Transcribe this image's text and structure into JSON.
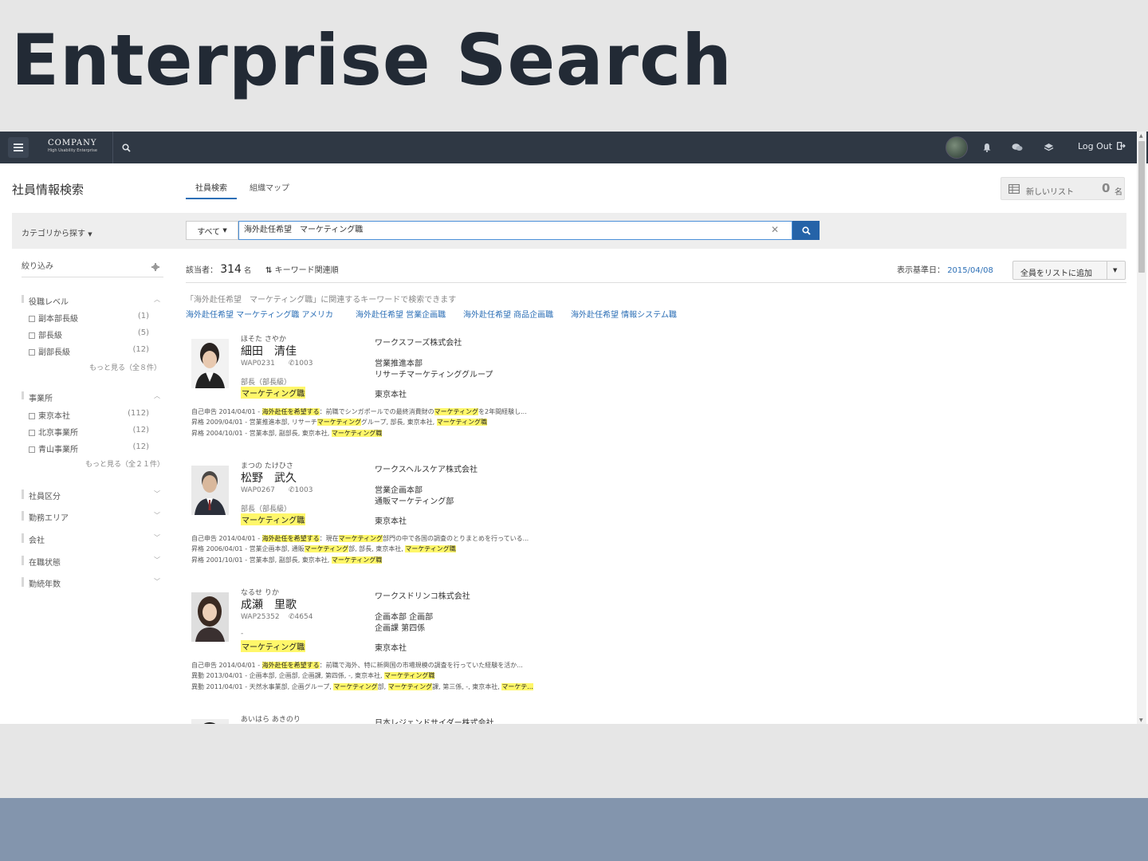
{
  "slide": {
    "title": "Enterprise Search"
  },
  "nav": {
    "logo_main": "COMPANY",
    "logo_sub": "High Usability Enterprise",
    "logout": "Log Out"
  },
  "page": {
    "title": "社員情報検索",
    "tabs": [
      "社員検索",
      "組織マップ"
    ],
    "new_list": "新しいリスト",
    "list_count": "0",
    "list_unit": "名"
  },
  "search": {
    "category": "カテゴリから探す",
    "scope": "すべて",
    "query": "海外赴任希望　マーケティング職"
  },
  "sidebar": {
    "heading": "絞り込み",
    "groups": [
      {
        "title": "役職レベル",
        "items": [
          {
            "label": "副本部長級",
            "count": "(1)"
          },
          {
            "label": "部長級",
            "count": "(5)"
          },
          {
            "label": "副部長級",
            "count": "(12)"
          }
        ],
        "more": "もっと見る（全８件）"
      },
      {
        "title": "事業所",
        "items": [
          {
            "label": "東京本社",
            "count": "(112)"
          },
          {
            "label": "北京事業所",
            "count": "(12)"
          },
          {
            "label": "青山事業所",
            "count": "(12)"
          }
        ],
        "more": "もっと見る（全２１件）"
      }
    ],
    "collapsed": [
      "社員区分",
      "勤務エリア",
      "会社",
      "在職状態",
      "勤続年数"
    ]
  },
  "results": {
    "count_label": "該当者：",
    "count": "314",
    "count_unit": "名",
    "sort_label": "キーワード関連順",
    "date_label": "表示基準日：",
    "date": "2015/04/08",
    "add_all": "全員をリストに追加",
    "hint": "「海外赴任希望　マーケティング職」に関連するキーワードで検索できます",
    "keywords": [
      "海外赴任希望 マーケティング職 アメリカ",
      "海外赴任希望 営業企画職",
      "海外赴任希望 商品企画職",
      "海外赴任希望 情報システム職"
    ],
    "people": [
      {
        "kana": "ほそた さやか",
        "name": "細田　清佳",
        "emp_id": "WAP0231",
        "phone": "1003",
        "title": "部長（部長級）",
        "job": "マーケティング職",
        "company": "ワークスフーズ株式会社",
        "dept1": "営業推進本部",
        "dept2": "リサーチマーケティンググループ",
        "office": "東京本社",
        "history": [
          [
            {
              "t": "自己申告  2014/04/01 - "
            },
            {
              "t": "海外赴任を希望する",
              "h": true
            },
            {
              "t": "：前職でシンガポールでの最終消費財の"
            },
            {
              "t": "マーケティング",
              "h": true
            },
            {
              "t": "を2年間経験し..."
            }
          ],
          [
            {
              "t": "昇格  2009/04/01 - 営業推進本部, リサーチ"
            },
            {
              "t": "マーケティング",
              "h": true
            },
            {
              "t": "グループ, 部長, 東京本社, "
            },
            {
              "t": "マーケティング職",
              "h": true
            }
          ],
          [
            {
              "t": "昇格  2004/10/01 - 営業本部, 副部長, 東京本社, "
            },
            {
              "t": "マーケティング職",
              "h": true
            }
          ]
        ]
      },
      {
        "kana": "まつの たけひさ",
        "name": "松野　武久",
        "emp_id": "WAP0267",
        "phone": "1003",
        "title": "部長（部長級）",
        "job": "マーケティング職",
        "company": "ワークスヘルスケア株式会社",
        "dept1": "営業企画本部",
        "dept2": "通販マーケティング部",
        "office": "東京本社",
        "history": [
          [
            {
              "t": "自己申告  2014/04/01 - "
            },
            {
              "t": "海外赴任を希望する",
              "h": true
            },
            {
              "t": "：現在"
            },
            {
              "t": "マーケティング",
              "h": true
            },
            {
              "t": "部門の中で各国の調査のとりまとめを行っている..."
            }
          ],
          [
            {
              "t": "昇格  2006/04/01 - 営業企画本部, 通販"
            },
            {
              "t": "マーケティング",
              "h": true
            },
            {
              "t": "部, 部長, 東京本社, "
            },
            {
              "t": "マーケティング職",
              "h": true
            }
          ],
          [
            {
              "t": "昇格  2001/10/01 - 営業本部, 副部長, 東京本社, "
            },
            {
              "t": "マーケティング職",
              "h": true
            }
          ]
        ]
      },
      {
        "kana": "なるせ りか",
        "name": "成瀬　里歌",
        "emp_id": "WAP25352",
        "phone": "4654",
        "title": "-",
        "job": "マーケティング職",
        "company": "ワークスドリンコ株式会社",
        "dept1": "企画本部 企画部",
        "dept2": "企画課 第四係",
        "office": "東京本社",
        "history": [
          [
            {
              "t": "自己申告  2014/04/01 - "
            },
            {
              "t": "海外赴任を希望する",
              "h": true
            },
            {
              "t": "：前職で海外、特に新興国の市場規模の調査を行っていた経験を活か..."
            }
          ],
          [
            {
              "t": "異動  2013/04/01 - 企画本部, 企画部, 企画課, 第四係, -, 東京本社, "
            },
            {
              "t": "マーケティング職",
              "h": true
            }
          ],
          [
            {
              "t": "異動  2011/04/01 - 天然水事業部, 企画グループ, "
            },
            {
              "t": "マーケティング",
              "h": true
            },
            {
              "t": "部, "
            },
            {
              "t": "マーケティング",
              "h": true
            },
            {
              "t": "課, 第三係, -, 東京本社, "
            },
            {
              "t": "マーケテ...",
              "h": true
            }
          ]
        ]
      },
      {
        "kana": "あいはら あきのり",
        "company": "日本レジェンドサイダー株式会社"
      }
    ]
  }
}
